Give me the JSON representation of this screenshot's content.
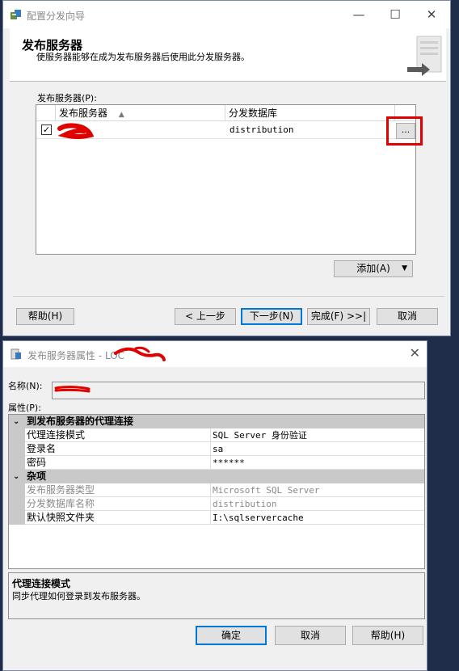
{
  "wizard": {
    "title": "配置分发向导",
    "min_glyph": "—",
    "max_glyph": "☐",
    "close_glyph": "✕",
    "header_title": "发布服务器",
    "header_subtitle": "使服务器能够在成为发布服务器后使用此分发服务器。",
    "publishers_label": "发布服务器(P):",
    "grid": {
      "col_publisher": "发布服务器",
      "col_database": "分发数据库",
      "sort_glyph": "▲",
      "rows": [
        {
          "checked": true,
          "check_glyph": "✓",
          "publisher": "",
          "database": "distribution"
        }
      ],
      "ellipsis": "..."
    },
    "add_button": "添加(A)",
    "add_arrow": "▼",
    "help_button": "帮助(H)",
    "back_button": "< 上一步",
    "next_button": "下一步(N)",
    "finish_button": "完成(F) >>|",
    "cancel_button": "取消"
  },
  "properties": {
    "title": "发布服务器属性 - LOC",
    "close_glyph": "✕",
    "name_label": "名称(N):",
    "name_value": "",
    "attributes_label": "属性(P):",
    "categories": [
      {
        "toggle": "⌄",
        "name": "到发布服务器的代理连接",
        "rows": [
          {
            "key": "代理连接模式",
            "value": "SQL Server 身份验证",
            "enabled": true
          },
          {
            "key": "登录名",
            "value": "sa",
            "enabled": true
          },
          {
            "key": "密码",
            "value": "******",
            "enabled": true
          }
        ]
      },
      {
        "toggle": "⌄",
        "name": "杂项",
        "rows": [
          {
            "key": "发布服务器类型",
            "value": "Microsoft SQL Server",
            "enabled": false
          },
          {
            "key": "分发数据库名称",
            "value": "distribution",
            "enabled": false
          },
          {
            "key": "默认快照文件夹",
            "value": "I:\\sqlservercache",
            "enabled": true
          }
        ]
      }
    ],
    "description_title": "代理连接模式",
    "description_text": "同步代理如何登录到发布服务器。",
    "ok_button": "确定",
    "cancel_button": "取消",
    "help_button": "帮助(H)"
  },
  "colors": {
    "highlight_box": "#e00000",
    "redaction": "#e00000",
    "category_bg": "#c9c9c9",
    "default_button_border": "#0078d7"
  }
}
